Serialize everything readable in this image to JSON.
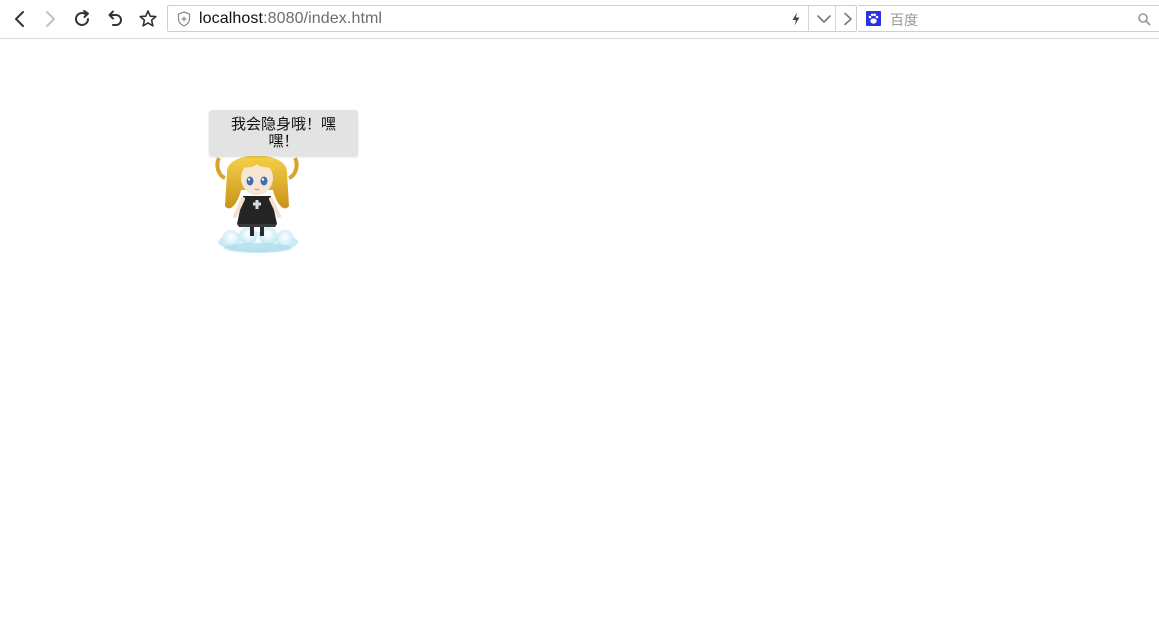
{
  "browser": {
    "address": {
      "host": "localhost",
      "rest": ":8080/index.html"
    },
    "search": {
      "placeholder": "百度",
      "engine_icon": "baidu-paw-icon"
    },
    "icons": {
      "back": "chevron-left-icon",
      "forward": "chevron-right-icon",
      "reload": "reload-icon",
      "undo": "undo-icon",
      "bookmark": "star-icon",
      "security": "shield-icon",
      "speed": "lightning-icon",
      "dropdown": "chevron-down-icon",
      "go": "chevron-right-icon",
      "search": "magnifier-icon"
    }
  },
  "page": {
    "bubble_text": "我会隐身哦！嘿嘿！",
    "mascot": "anime-girl-on-cloud-image"
  },
  "colors": {
    "bubble_bg": "#e3e3e3",
    "engine_blue": "#2932e1",
    "url_host": "#111111",
    "url_rest": "#6d6d6d"
  }
}
